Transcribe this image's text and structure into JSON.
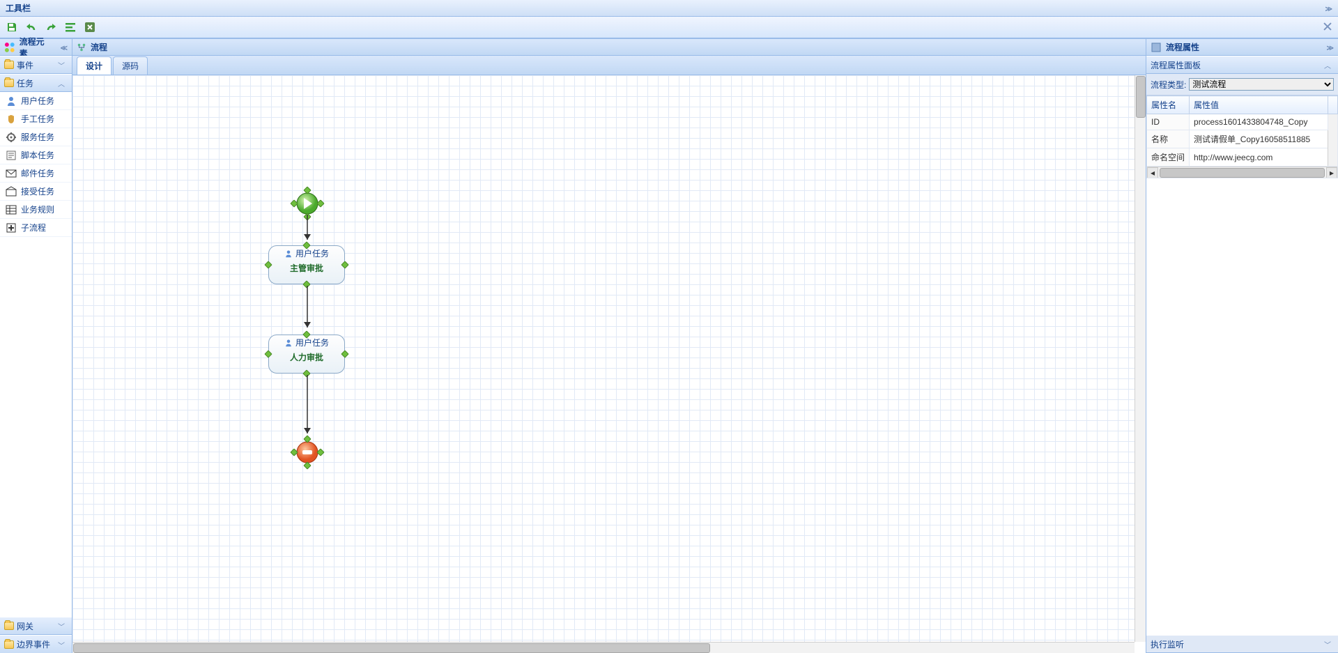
{
  "toolbar": {
    "title": "工具栏"
  },
  "left": {
    "title": "流程元素",
    "sections": {
      "events": "事件",
      "tasks": "任务",
      "gateways": "网关",
      "boundary": "边界事件"
    },
    "task_items": [
      {
        "label": "用户任务"
      },
      {
        "label": "手工任务"
      },
      {
        "label": "服务任务"
      },
      {
        "label": "脚本任务"
      },
      {
        "label": "邮件任务"
      },
      {
        "label": "接受任务"
      },
      {
        "label": "业务规则"
      },
      {
        "label": "子流程"
      }
    ]
  },
  "center": {
    "title": "流程",
    "tabs": {
      "design": "设计",
      "source": "源码"
    }
  },
  "flow": {
    "user_task_label": "用户任务",
    "task1": "主管审批",
    "task2": "人力审批"
  },
  "right": {
    "title": "流程属性",
    "panel_title": "流程属性面板",
    "type_label": "流程类型:",
    "type_value": "测试流程",
    "headers": {
      "name": "属性名",
      "value": "属性值"
    },
    "rows": [
      {
        "name": "ID",
        "value": "process1601433804748_Copy"
      },
      {
        "name": "名称",
        "value": "测试请假单_Copy16058511885"
      },
      {
        "name": "命名空间",
        "value": "http://www.jeecg.com"
      }
    ],
    "listener_title": "执行监听"
  }
}
